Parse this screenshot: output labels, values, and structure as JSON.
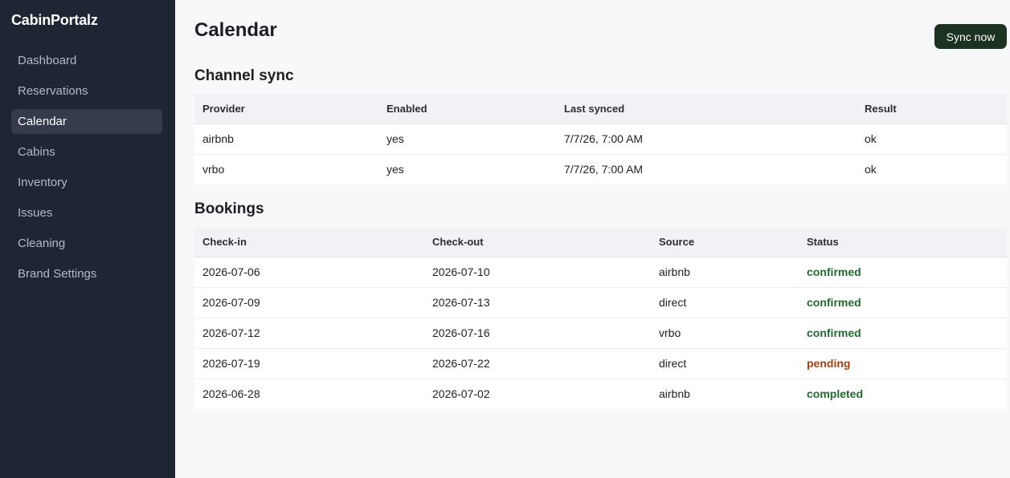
{
  "sidebar": {
    "brand": "CabinPortalz",
    "items": [
      {
        "label": "Dashboard"
      },
      {
        "label": "Reservations"
      },
      {
        "label": "Calendar",
        "active": true
      },
      {
        "label": "Cabins"
      },
      {
        "label": "Inventory"
      },
      {
        "label": "Issues"
      },
      {
        "label": "Cleaning"
      },
      {
        "label": "Brand Settings"
      }
    ]
  },
  "main": {
    "title": "Calendar",
    "sync_button_label": "Sync now",
    "channel_sync": {
      "title": "Channel sync",
      "headers": [
        "Provider",
        "Enabled",
        "Last synced",
        "Result"
      ],
      "rows": [
        [
          "airbnb",
          "yes",
          "7/7/26, 7:00 AM",
          "ok"
        ],
        [
          "vrbo",
          "yes",
          "7/7/26, 7:00 AM",
          "ok"
        ]
      ]
    },
    "bookings": {
      "title": "Bookings",
      "headers": [
        "Check-in",
        "Check-out",
        "Source",
        "Status"
      ],
      "rows": [
        [
          "2026-07-06",
          "2026-07-10",
          "airbnb",
          "confirmed"
        ],
        [
          "2026-07-09",
          "2026-07-13",
          "direct",
          "confirmed"
        ],
        [
          "2026-07-12",
          "2026-07-16",
          "vrbo",
          "confirmed"
        ],
        [
          "2026-07-19",
          "2026-07-22",
          "direct",
          "pending"
        ],
        [
          "2026-06-28",
          "2026-07-02",
          "airbnb",
          "completed"
        ]
      ]
    }
  },
  "colors": {
    "sidebar_bg": "#1f2633",
    "sync_button": "#1d3322",
    "status_confirmed": "#1f6b2e",
    "status_completed": "#1f6b2e",
    "status_pending": "#a3410d"
  }
}
